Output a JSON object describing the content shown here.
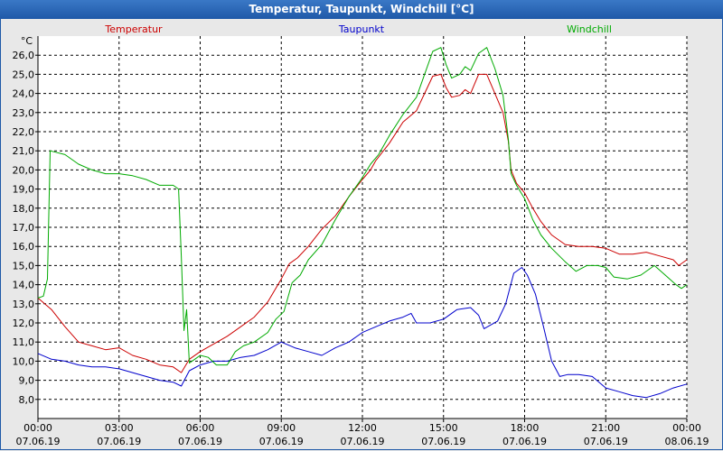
{
  "window": {
    "title": "Temperatur, Taupunkt, Windchill [°C]"
  },
  "chart_data": {
    "type": "line",
    "unit": "°C",
    "ylim": [
      7.0,
      27.0
    ],
    "yticks": [
      "8,0",
      "9,0",
      "10,0",
      "11,0",
      "12,0",
      "13,0",
      "14,0",
      "15,0",
      "16,0",
      "17,0",
      "18,0",
      "19,0",
      "20,0",
      "21,0",
      "22,0",
      "23,0",
      "24,0",
      "25,0",
      "26,0"
    ],
    "xlim": [
      0,
      24
    ],
    "xticks": [
      {
        "hour": 0,
        "time": "00:00",
        "date": "07.06.19"
      },
      {
        "hour": 3,
        "time": "03:00",
        "date": "07.06.19"
      },
      {
        "hour": 6,
        "time": "06:00",
        "date": "07.06.19"
      },
      {
        "hour": 9,
        "time": "09:00",
        "date": "07.06.19"
      },
      {
        "hour": 12,
        "time": "12:00",
        "date": "07.06.19"
      },
      {
        "hour": 15,
        "time": "15:00",
        "date": "07.06.19"
      },
      {
        "hour": 18,
        "time": "18:00",
        "date": "07.06.19"
      },
      {
        "hour": 21,
        "time": "21:00",
        "date": "07.06.19"
      },
      {
        "hour": 24,
        "time": "00:00",
        "date": "08.06.19"
      }
    ],
    "grid": true,
    "legend_placement": "top",
    "series": [
      {
        "name": "Temperatur",
        "color": "#cc0000",
        "points": [
          [
            0.0,
            13.3
          ],
          [
            0.5,
            12.7
          ],
          [
            1.0,
            11.8
          ],
          [
            1.5,
            11.0
          ],
          [
            2.0,
            10.8
          ],
          [
            2.5,
            10.6
          ],
          [
            3.0,
            10.7
          ],
          [
            3.5,
            10.3
          ],
          [
            4.0,
            10.1
          ],
          [
            4.5,
            9.8
          ],
          [
            5.0,
            9.7
          ],
          [
            5.3,
            9.4
          ],
          [
            5.6,
            10.1
          ],
          [
            6.0,
            10.5
          ],
          [
            6.5,
            10.9
          ],
          [
            7.0,
            11.3
          ],
          [
            7.5,
            11.8
          ],
          [
            8.0,
            12.3
          ],
          [
            8.5,
            13.1
          ],
          [
            9.0,
            14.3
          ],
          [
            9.3,
            15.1
          ],
          [
            9.6,
            15.4
          ],
          [
            10.0,
            16.0
          ],
          [
            10.5,
            16.9
          ],
          [
            11.0,
            17.6
          ],
          [
            11.5,
            18.6
          ],
          [
            12.0,
            19.5
          ],
          [
            12.3,
            20.0
          ],
          [
            12.5,
            20.5
          ],
          [
            13.0,
            21.4
          ],
          [
            13.5,
            22.5
          ],
          [
            14.0,
            23.1
          ],
          [
            14.3,
            24.0
          ],
          [
            14.6,
            24.9
          ],
          [
            14.9,
            25.0
          ],
          [
            15.1,
            24.3
          ],
          [
            15.3,
            23.8
          ],
          [
            15.6,
            23.9
          ],
          [
            15.8,
            24.2
          ],
          [
            16.0,
            24.0
          ],
          [
            16.3,
            25.0
          ],
          [
            16.6,
            25.0
          ],
          [
            16.9,
            24.0
          ],
          [
            17.2,
            23.0
          ],
          [
            17.4,
            21.5
          ],
          [
            17.5,
            20.0
          ],
          [
            17.7,
            19.3
          ],
          [
            18.0,
            18.8
          ],
          [
            18.3,
            18.0
          ],
          [
            18.6,
            17.3
          ],
          [
            19.0,
            16.6
          ],
          [
            19.5,
            16.1
          ],
          [
            20.0,
            16.0
          ],
          [
            20.5,
            16.0
          ],
          [
            21.0,
            15.9
          ],
          [
            21.5,
            15.6
          ],
          [
            22.0,
            15.6
          ],
          [
            22.5,
            15.7
          ],
          [
            23.0,
            15.5
          ],
          [
            23.5,
            15.3
          ],
          [
            23.7,
            15.0
          ],
          [
            24.0,
            15.3
          ]
        ]
      },
      {
        "name": "Taupunkt",
        "color": "#0000cc",
        "points": [
          [
            0.0,
            10.4
          ],
          [
            0.5,
            10.1
          ],
          [
            1.0,
            10.0
          ],
          [
            1.5,
            9.8
          ],
          [
            2.0,
            9.7
          ],
          [
            2.5,
            9.7
          ],
          [
            3.0,
            9.6
          ],
          [
            3.5,
            9.4
          ],
          [
            4.0,
            9.2
          ],
          [
            4.5,
            9.0
          ],
          [
            5.0,
            8.9
          ],
          [
            5.3,
            8.7
          ],
          [
            5.6,
            9.5
          ],
          [
            6.0,
            9.8
          ],
          [
            6.5,
            10.0
          ],
          [
            7.0,
            10.0
          ],
          [
            7.5,
            10.2
          ],
          [
            8.0,
            10.3
          ],
          [
            8.5,
            10.6
          ],
          [
            9.0,
            11.0
          ],
          [
            9.5,
            10.7
          ],
          [
            10.0,
            10.5
          ],
          [
            10.5,
            10.3
          ],
          [
            11.0,
            10.7
          ],
          [
            11.5,
            11.0
          ],
          [
            12.0,
            11.5
          ],
          [
            12.5,
            11.8
          ],
          [
            13.0,
            12.1
          ],
          [
            13.5,
            12.3
          ],
          [
            13.8,
            12.5
          ],
          [
            14.0,
            12.0
          ],
          [
            14.5,
            12.0
          ],
          [
            15.0,
            12.2
          ],
          [
            15.5,
            12.7
          ],
          [
            16.0,
            12.8
          ],
          [
            16.3,
            12.4
          ],
          [
            16.5,
            11.7
          ],
          [
            17.0,
            12.1
          ],
          [
            17.3,
            13.0
          ],
          [
            17.6,
            14.6
          ],
          [
            17.9,
            14.9
          ],
          [
            18.1,
            14.5
          ],
          [
            18.4,
            13.5
          ],
          [
            18.7,
            11.8
          ],
          [
            19.0,
            10.0
          ],
          [
            19.3,
            9.2
          ],
          [
            19.6,
            9.3
          ],
          [
            20.0,
            9.3
          ],
          [
            20.5,
            9.2
          ],
          [
            21.0,
            8.6
          ],
          [
            21.5,
            8.4
          ],
          [
            22.0,
            8.2
          ],
          [
            22.5,
            8.1
          ],
          [
            23.0,
            8.3
          ],
          [
            23.5,
            8.6
          ],
          [
            24.0,
            8.8
          ]
        ]
      },
      {
        "name": "Windchill",
        "color": "#00aa00",
        "points": [
          [
            0.0,
            13.3
          ],
          [
            0.2,
            13.4
          ],
          [
            0.35,
            14.3
          ],
          [
            0.45,
            21.0
          ],
          [
            1.0,
            20.8
          ],
          [
            1.5,
            20.3
          ],
          [
            2.0,
            20.0
          ],
          [
            2.5,
            19.8
          ],
          [
            3.0,
            19.8
          ],
          [
            3.5,
            19.7
          ],
          [
            4.0,
            19.5
          ],
          [
            4.5,
            19.2
          ],
          [
            5.0,
            19.2
          ],
          [
            5.2,
            19.0
          ],
          [
            5.3,
            15.5
          ],
          [
            5.4,
            11.6
          ],
          [
            5.5,
            12.7
          ],
          [
            5.6,
            9.9
          ],
          [
            5.8,
            10.1
          ],
          [
            6.0,
            10.3
          ],
          [
            6.3,
            10.2
          ],
          [
            6.6,
            9.8
          ],
          [
            7.0,
            9.8
          ],
          [
            7.3,
            10.5
          ],
          [
            7.6,
            10.8
          ],
          [
            8.0,
            11.0
          ],
          [
            8.5,
            11.5
          ],
          [
            8.8,
            12.2
          ],
          [
            9.1,
            12.6
          ],
          [
            9.4,
            14.1
          ],
          [
            9.7,
            14.5
          ],
          [
            10.0,
            15.3
          ],
          [
            10.5,
            16.1
          ],
          [
            11.0,
            17.4
          ],
          [
            11.5,
            18.6
          ],
          [
            12.0,
            19.6
          ],
          [
            12.3,
            20.3
          ],
          [
            12.6,
            20.8
          ],
          [
            13.0,
            21.8
          ],
          [
            13.5,
            22.9
          ],
          [
            14.0,
            23.8
          ],
          [
            14.3,
            25.0
          ],
          [
            14.6,
            26.2
          ],
          [
            14.9,
            26.4
          ],
          [
            15.1,
            25.5
          ],
          [
            15.3,
            24.8
          ],
          [
            15.6,
            25.0
          ],
          [
            15.8,
            25.4
          ],
          [
            16.0,
            25.2
          ],
          [
            16.3,
            26.1
          ],
          [
            16.6,
            26.4
          ],
          [
            16.9,
            25.3
          ],
          [
            17.2,
            23.9
          ],
          [
            17.4,
            21.6
          ],
          [
            17.5,
            19.8
          ],
          [
            17.7,
            19.2
          ],
          [
            18.0,
            18.5
          ],
          [
            18.3,
            17.4
          ],
          [
            18.6,
            16.6
          ],
          [
            19.0,
            15.9
          ],
          [
            19.5,
            15.2
          ],
          [
            19.9,
            14.7
          ],
          [
            20.3,
            15.0
          ],
          [
            20.7,
            15.0
          ],
          [
            21.0,
            14.9
          ],
          [
            21.3,
            14.4
          ],
          [
            21.8,
            14.3
          ],
          [
            22.3,
            14.5
          ],
          [
            22.8,
            15.0
          ],
          [
            23.2,
            14.5
          ],
          [
            23.6,
            14.0
          ],
          [
            23.8,
            13.8
          ],
          [
            24.0,
            14.0
          ]
        ]
      }
    ]
  }
}
